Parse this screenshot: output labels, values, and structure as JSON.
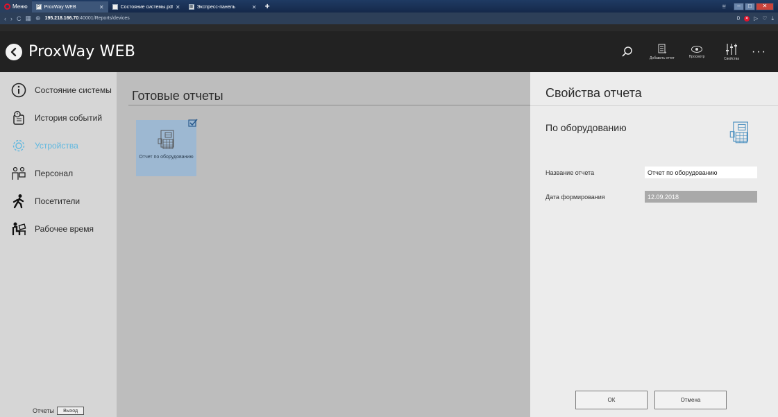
{
  "browser": {
    "menu_label": "Меню",
    "tabs": [
      {
        "title": "ProxWay WEB",
        "active": true
      },
      {
        "title": "Состояние системы.pdf",
        "active": false
      },
      {
        "title": "Экспресс-панель",
        "active": false
      }
    ],
    "new_tab": "+",
    "url_host": "195.218.166.70",
    "url_path": ":40001/Reports/devices",
    "adblock_count": "0"
  },
  "header": {
    "title": "ProxWay WEB",
    "tools": [
      {
        "icon": "search-icon",
        "label": ""
      },
      {
        "icon": "add-report-icon",
        "label": "Добавить отчет"
      },
      {
        "icon": "eye-icon",
        "label": "Просмотр"
      },
      {
        "icon": "sliders-icon",
        "label": "Свойства"
      }
    ],
    "more": "···"
  },
  "sidebar": {
    "items": [
      {
        "label": "Состояние системы",
        "icon": "info-circle-icon",
        "active": false
      },
      {
        "label": "История событий",
        "icon": "history-icon",
        "active": false
      },
      {
        "label": "Устройства",
        "icon": "gear-icon",
        "active": true
      },
      {
        "label": "Персонал",
        "icon": "staff-icon",
        "active": false
      },
      {
        "label": "Посетители",
        "icon": "walker-icon",
        "active": false
      },
      {
        "label": "Рабочее время",
        "icon": "worktime-icon",
        "active": false
      }
    ],
    "footer_label": "Отчеты",
    "exit_label": "Выход"
  },
  "main": {
    "title": "Готовые отчеты",
    "reports": [
      {
        "label": "Отчет по оборудованию",
        "selected": true
      }
    ]
  },
  "properties": {
    "title": "Свойства отчета",
    "subtitle": "По оборудованию",
    "fields": [
      {
        "label": "Название отчета",
        "value": "Отчет по оборудованию",
        "readonly": false
      },
      {
        "label": "Дата формирования",
        "value": "12.09.2018",
        "readonly": true
      }
    ],
    "ok_label": "ОК",
    "cancel_label": "Отмена"
  },
  "colors": {
    "accent": "#5fb8e0",
    "header_bg": "#222222",
    "card_bg": "#9db8d2"
  }
}
